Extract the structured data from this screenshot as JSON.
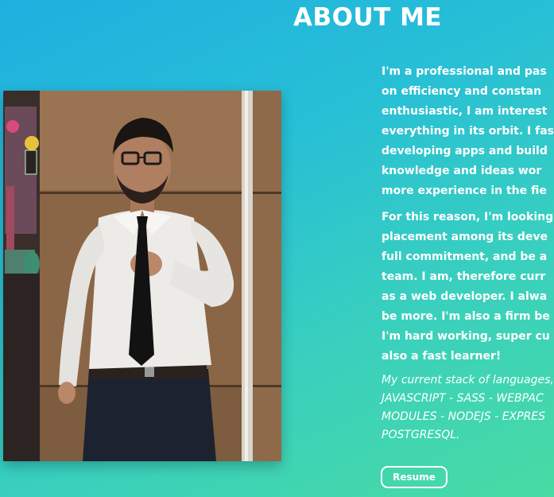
{
  "about": {
    "title": "ABOUT ME",
    "paragraph1": [
      "I'm a professional and pas",
      "on efficiency and constan",
      "enthusiastic, I am interest",
      "everything in its orbit. I fas",
      "developing apps and build",
      "knowledge and ideas wor",
      "more experience in the fie"
    ],
    "paragraph2": [
      "For this reason, I'm looking",
      "placement among its deve",
      "full commitment, and be a",
      "team. I am, therefore curr",
      "as a web developer. I alwa",
      "be more. I'm also a firm be",
      "I'm hard working, super cu",
      "also a fast learner!"
    ],
    "stack": [
      "My current stack of languages,",
      "JAVASCRIPT - SASS - WEBPAC",
      "MODULES - NODEJS - EXPRES",
      "POSTGRESQL."
    ],
    "resume_label": "Resume"
  }
}
